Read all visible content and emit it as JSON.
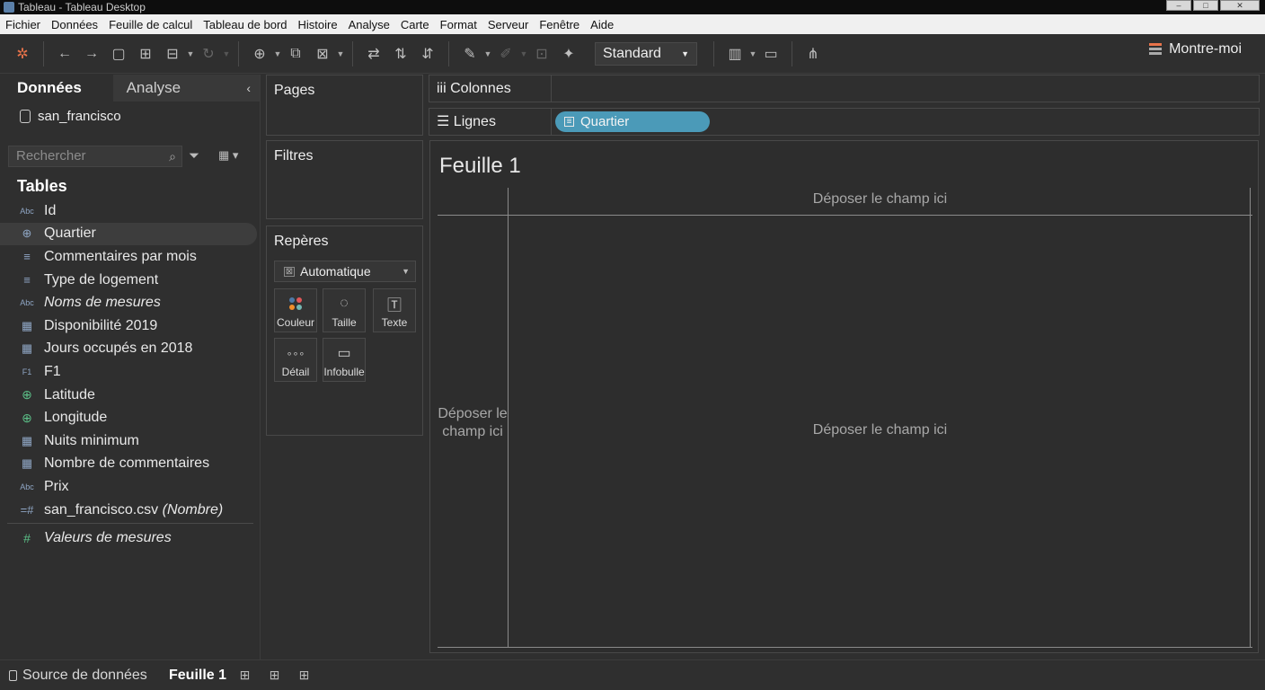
{
  "window": {
    "title": "Tableau - Tableau Desktop"
  },
  "menu": [
    "Fichier",
    "Données",
    "Feuille de calcul",
    "Tableau de bord",
    "Histoire",
    "Analyse",
    "Carte",
    "Format",
    "Serveur",
    "Fenêtre",
    "Aide"
  ],
  "toolbar": {
    "fit_select": "Standard",
    "show_me": "Montre-moi"
  },
  "datapane": {
    "tab_data": "Données",
    "tab_analysis": "Analyse",
    "datasource": "san_francisco",
    "search_placeholder": "Rechercher",
    "tables_heading": "Tables",
    "fields": [
      {
        "label": "Id",
        "icon": "Abc",
        "italic": false
      },
      {
        "label": "Quartier",
        "icon": "globe-icon",
        "italic": false,
        "selected": true
      },
      {
        "label": "Commentaires par mois",
        "icon": "string-list-icon",
        "italic": false
      },
      {
        "label": "Type de logement",
        "icon": "string-list-icon",
        "italic": false
      },
      {
        "label": "Noms de mesures",
        "icon": "Abc",
        "italic": true
      },
      {
        "label": "Disponibilité 2019",
        "icon": "table-icon",
        "italic": false
      },
      {
        "label": "Jours occupés en 2018",
        "icon": "table-icon",
        "italic": false
      },
      {
        "label": "F1",
        "icon": "F1",
        "italic": false
      },
      {
        "label": "Latitude",
        "icon": "globe-icon",
        "italic": false
      },
      {
        "label": "Longitude",
        "icon": "globe-icon",
        "italic": false
      },
      {
        "label": "Nuits minimum",
        "icon": "table-icon",
        "italic": false
      },
      {
        "label": "Nombre de commentaires",
        "icon": "table-icon",
        "italic": false
      },
      {
        "label": "Prix",
        "icon": "Abc",
        "italic": false
      },
      {
        "label": "san_francisco.csv",
        "suffix": "(Nombre)",
        "icon": "count-icon",
        "italic": false
      }
    ],
    "measure_values": "Valeurs de mesures"
  },
  "cards": {
    "pages": "Pages",
    "filters": "Filtres",
    "marks": "Repères",
    "mark_type": "Automatique",
    "buttons": {
      "color": "Couleur",
      "size": "Taille",
      "text": "Texte",
      "detail": "Détail",
      "tooltip": "Infobulle"
    }
  },
  "shelves": {
    "columns": "Colonnes",
    "rows": "Lignes",
    "rows_pill": "Quartier"
  },
  "canvas": {
    "sheet_title": "Feuille 1",
    "drop_top": "Déposer le champ ici",
    "drop_left": "Déposer le champ ici",
    "drop_center": "Déposer le champ ici"
  },
  "bottom": {
    "datasource_tab": "Source de données",
    "sheet_tab": "Feuille 1"
  },
  "colors": {
    "pill": "#4b9ab8",
    "geo_icon": "#5bbf87",
    "accent_orange": "#e8734a"
  }
}
